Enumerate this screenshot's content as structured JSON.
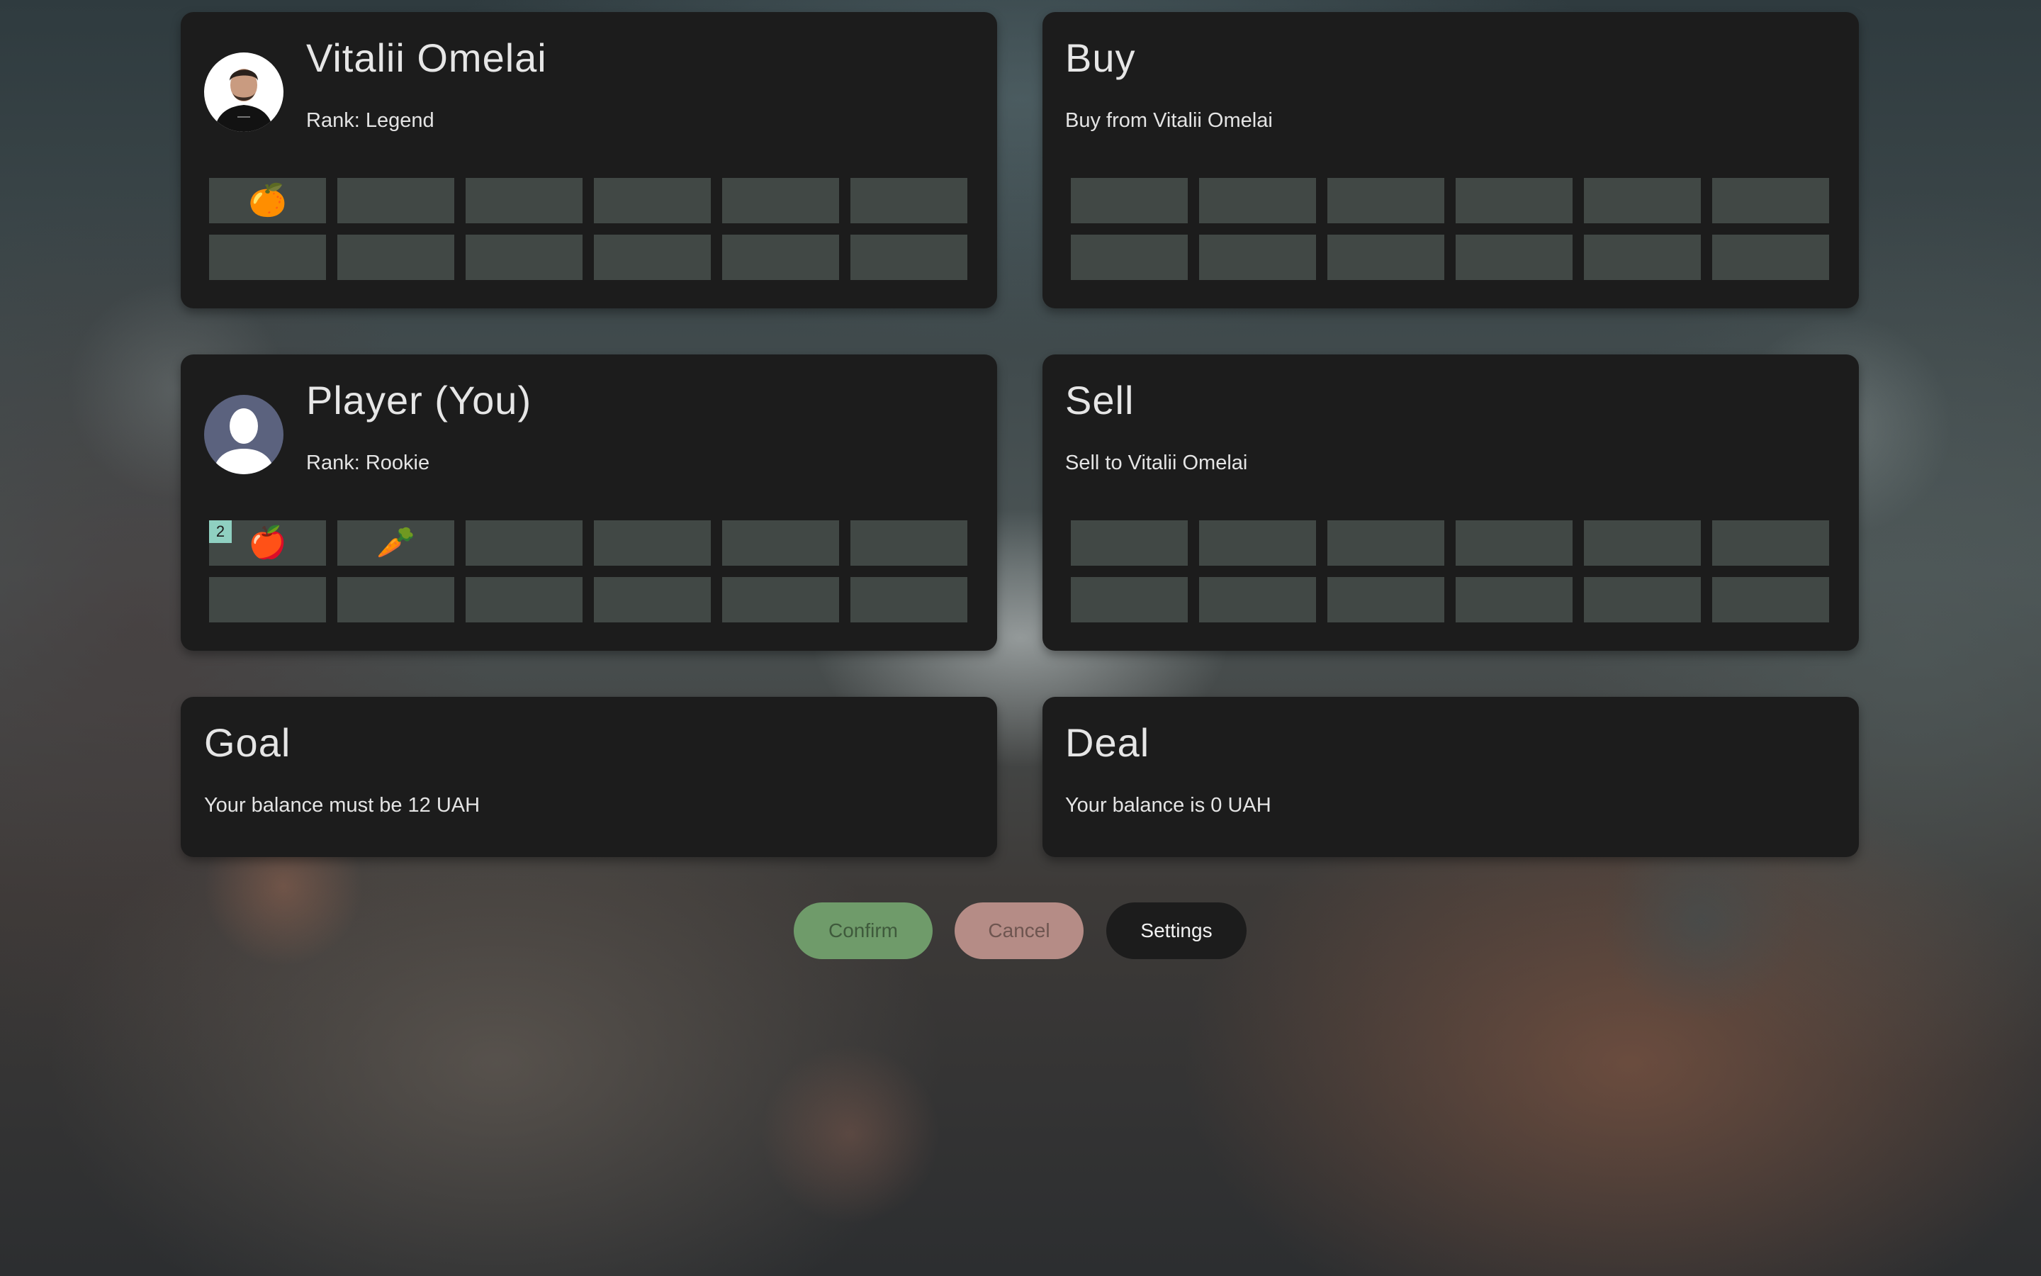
{
  "trader": {
    "name": "Vitalii Omelai",
    "rank": "Rank: Legend",
    "avatar_icon": "person-photo-icon",
    "inventory": [
      {
        "icon": "orange-icon",
        "glyph": "🍊",
        "count": ""
      },
      {
        "icon": "",
        "glyph": "",
        "count": ""
      },
      {
        "icon": "",
        "glyph": "",
        "count": ""
      },
      {
        "icon": "",
        "glyph": "",
        "count": ""
      },
      {
        "icon": "",
        "glyph": "",
        "count": ""
      },
      {
        "icon": "",
        "glyph": "",
        "count": ""
      },
      {
        "icon": "",
        "glyph": "",
        "count": ""
      },
      {
        "icon": "",
        "glyph": "",
        "count": ""
      },
      {
        "icon": "",
        "glyph": "",
        "count": ""
      },
      {
        "icon": "",
        "glyph": "",
        "count": ""
      },
      {
        "icon": "",
        "glyph": "",
        "count": ""
      },
      {
        "icon": "",
        "glyph": "",
        "count": ""
      }
    ]
  },
  "buy": {
    "title": "Buy",
    "subtitle": "Buy from Vitalii Omelai",
    "slots": 12
  },
  "player": {
    "name": "Player (You)",
    "rank": "Rank: Rookie",
    "avatar_icon": "user-silhouette-icon",
    "inventory": [
      {
        "icon": "apple-icon",
        "glyph": "🍎",
        "count": "2"
      },
      {
        "icon": "carrot-icon",
        "glyph": "🥕",
        "count": ""
      },
      {
        "icon": "",
        "glyph": "",
        "count": ""
      },
      {
        "icon": "",
        "glyph": "",
        "count": ""
      },
      {
        "icon": "",
        "glyph": "",
        "count": ""
      },
      {
        "icon": "",
        "glyph": "",
        "count": ""
      },
      {
        "icon": "",
        "glyph": "",
        "count": ""
      },
      {
        "icon": "",
        "glyph": "",
        "count": ""
      },
      {
        "icon": "",
        "glyph": "",
        "count": ""
      },
      {
        "icon": "",
        "glyph": "",
        "count": ""
      },
      {
        "icon": "",
        "glyph": "",
        "count": ""
      },
      {
        "icon": "",
        "glyph": "",
        "count": ""
      }
    ]
  },
  "sell": {
    "title": "Sell",
    "subtitle": "Sell to Vitalii Omelai",
    "slots": 12
  },
  "goal": {
    "title": "Goal",
    "text": "Your balance must be 12 UAH"
  },
  "deal": {
    "title": "Deal",
    "text": "Your balance is 0 UAH"
  },
  "actions": {
    "confirm_label": "Confirm",
    "cancel_label": "Cancel",
    "settings_label": "Settings"
  },
  "colors": {
    "card_bg": "#1c1c1c",
    "slot_bg": "#414845",
    "badge_bg": "#8fd0c1",
    "confirm_bg": "#6f9b6a",
    "cancel_bg": "#b58c86",
    "settings_bg": "#1c1c1c"
  }
}
